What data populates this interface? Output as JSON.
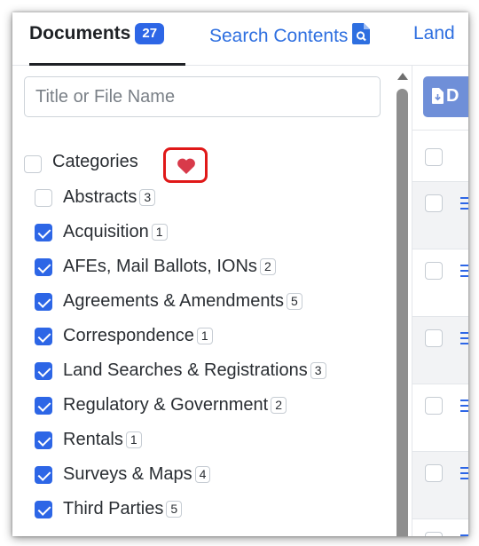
{
  "tabs": {
    "documents_label": "Documents",
    "documents_count": "27",
    "search_label": "Search Contents",
    "land_label": "Land"
  },
  "filter": {
    "search_placeholder": "Title or File Name",
    "categories_label": "Categories",
    "categories": [
      {
        "label": "Abstracts",
        "count": "3",
        "checked": false
      },
      {
        "label": "Acquisition",
        "count": "1",
        "checked": true
      },
      {
        "label": "AFEs, Mail Ballots, IONs",
        "count": "2",
        "checked": true
      },
      {
        "label": "Agreements & Amendments",
        "count": "5",
        "checked": true
      },
      {
        "label": "Correspondence",
        "count": "1",
        "checked": true
      },
      {
        "label": "Land Searches & Registrations",
        "count": "3",
        "checked": true
      },
      {
        "label": "Regulatory & Government",
        "count": "2",
        "checked": true
      },
      {
        "label": "Rentals",
        "count": "1",
        "checked": true
      },
      {
        "label": "Surveys & Maps",
        "count": "4",
        "checked": true
      },
      {
        "label": "Third Parties",
        "count": "5",
        "checked": true
      }
    ]
  },
  "right_panel": {
    "download_button_label": "D"
  },
  "colors": {
    "accent": "#2d66e6",
    "favorite_heart": "#d83a4a",
    "highlight_border": "#e01818"
  }
}
